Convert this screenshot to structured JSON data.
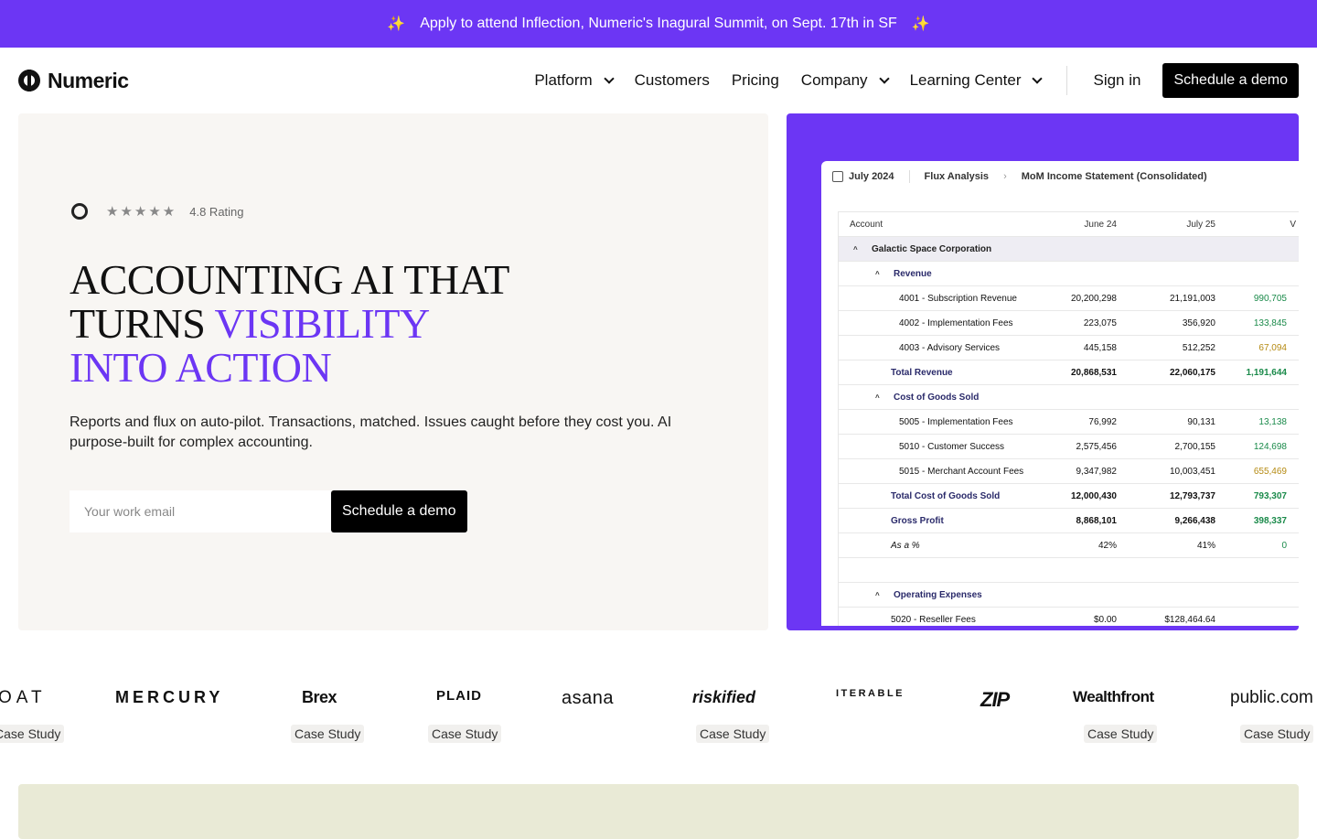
{
  "banner": {
    "text": "Apply to attend Inflection, Numeric's Inagural Summit, on Sept. 17th in SF",
    "icon": "sparkle-icon",
    "color": "#6c36f4"
  },
  "nav": {
    "brand": "Numeric",
    "items": [
      "Platform",
      "Customers",
      "Pricing",
      "Company",
      "Learning Center"
    ],
    "sign_in": "Sign in",
    "cta": "Schedule a demo"
  },
  "hero": {
    "rating": "4.8 Rating",
    "stars": "★★★★★",
    "headline_line1": "ACCOUNTING AI THAT",
    "headline_line2a": "TURNS ",
    "headline_line2b": "VISIBILITY",
    "headline_line3": "INTO ACTION",
    "subcopy": "Reports and flux on auto-pilot. Transactions, matched. Issues caught before they cost you. AI purpose-built for complex accounting.",
    "email_placeholder": "Your work email",
    "cta": "Schedule a demo",
    "accent": "#6c36f4"
  },
  "report": {
    "period": "July 2024",
    "crumb1": "Flux Analysis",
    "crumb2": "MoM Income Statement (Consolidated)",
    "headers": [
      "Account",
      "June 24",
      "July 25",
      "V"
    ],
    "rows": [
      {
        "label": "Galactic Space Corporation",
        "kind": "group"
      },
      {
        "label": "Revenue",
        "kind": "sub"
      },
      {
        "label": "4001 - Subscription Revenue",
        "kind": "line",
        "a": "20,200,298",
        "b": "21,191,003",
        "v": "990,705",
        "vc": "up"
      },
      {
        "label": "4002 - Implementation Fees",
        "kind": "line",
        "a": "223,075",
        "b": "356,920",
        "v": "133,845",
        "vc": "up"
      },
      {
        "label": "4003 - Advisory Services",
        "kind": "line",
        "a": "445,158",
        "b": "512,252",
        "v": "67,094",
        "vc": "warn"
      },
      {
        "label": "Total Revenue",
        "kind": "total",
        "a": "20,868,531",
        "b": "22,060,175",
        "v": "1,191,644",
        "vc": "up"
      },
      {
        "label": "Cost of Goods Sold",
        "kind": "sub"
      },
      {
        "label": "5005 - Implementation Fees",
        "kind": "line",
        "a": "76,992",
        "b": "90,131",
        "v": "13,138",
        "vc": "up"
      },
      {
        "label": "5010 - Customer Success",
        "kind": "line",
        "a": "2,575,456",
        "b": "2,700,155",
        "v": "124,698",
        "vc": "up"
      },
      {
        "label": "5015 - Merchant Account Fees",
        "kind": "line",
        "a": "9,347,982",
        "b": "10,003,451",
        "v": "655,469",
        "vc": "warn"
      },
      {
        "label": "Total Cost of Goods Sold",
        "kind": "total",
        "a": "12,000,430",
        "b": "12,793,737",
        "v": "793,307",
        "vc": "up"
      },
      {
        "label": "Gross Profit",
        "kind": "total",
        "a": "8,868,101",
        "b": "9,266,438",
        "v": "398,337",
        "vc": "up"
      },
      {
        "label": "As a %",
        "kind": "italic",
        "a": "42%",
        "b": "41%",
        "v": "0",
        "vc": "up"
      },
      {
        "label": "",
        "kind": "empty"
      },
      {
        "label": "Operating Expenses",
        "kind": "sub"
      },
      {
        "label": "5020 - Reseller Fees",
        "kind": "line",
        "a": "$0.00",
        "b": "$128,464.64",
        "v": "",
        "vc": "up"
      }
    ]
  },
  "logos": {
    "items": [
      {
        "name": "OAT",
        "case": "Case Study"
      },
      {
        "name": "MERCURY"
      },
      {
        "name": "Brex",
        "case": "Case Study"
      },
      {
        "name": "PLAID",
        "case": "Case Study"
      },
      {
        "name": "asana"
      },
      {
        "name": "riskified",
        "case": "Case Study"
      },
      {
        "name": "ITERABLE"
      },
      {
        "name": "ZIP"
      },
      {
        "name": "Wealthfront",
        "case": "Case Study"
      },
      {
        "name": "public.com",
        "case": "Case Study"
      }
    ]
  }
}
